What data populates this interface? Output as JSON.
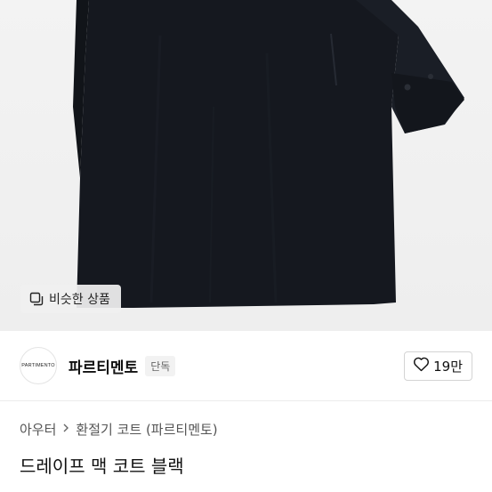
{
  "product": {
    "similar_button_label": "비슷한 상품",
    "title": "드레이프 맥 코트 블랙"
  },
  "seller": {
    "logo_text": "PARTIMENTO",
    "name": "파르티멘토",
    "tag": "단독"
  },
  "like": {
    "count": "19만",
    "icon": "heart-outline-icon"
  },
  "breadcrumb": {
    "items": [
      "아우터",
      "환절기 코트 (파르티멘토)"
    ],
    "separator_icon": "chevron-right-icon"
  },
  "colors": {
    "coat": "#15181f",
    "background": "#f0f0f0",
    "text": "#111111"
  }
}
